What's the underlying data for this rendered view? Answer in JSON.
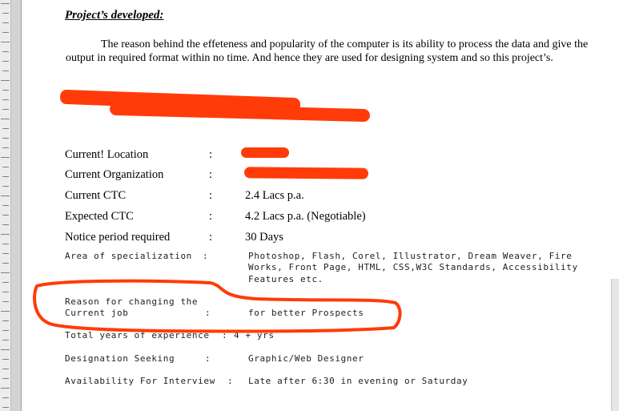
{
  "document": {
    "heading": "Project’s developed:",
    "paragraph": "The reason behind the effeteness and popularity of the computer is its ability to process the data and give the output in required format within no time. And hence they are used for designing system and so this project’s.",
    "colon": ":",
    "details": [
      {
        "label": "Current! Location",
        "value": ""
      },
      {
        "label": "Current Organization",
        "value": ""
      },
      {
        "label": "Current CTC",
        "value": "2.4 Lacs p.a."
      },
      {
        "label": "Expected CTC",
        "value": "4.2 Lacs p.a. (Negotiable)"
      },
      {
        "label": "Notice period required",
        "value": "30 Days"
      }
    ],
    "specialization": {
      "label": "Area of specialization",
      "value_line1": "Photoshop, Flash, Corel, Illustrator, Dream Weaver, Fire",
      "value_line2": "Works, Front Page, HTML, CSS,W3C Standards, Accessibility",
      "value_line3": "Features etc."
    },
    "reason": {
      "label_line1": "Reason for changing the",
      "label_line2": "Current job",
      "value": "for better Prospects"
    },
    "experience": {
      "label": "Total years of experience",
      "value": "4 + yrs"
    },
    "designation": {
      "label": "Designation Seeking",
      "value": "Graphic/Web Designer"
    },
    "availability": {
      "label": "Availability For Interview",
      "value": "Late after 6:30 in evening or Saturday"
    }
  },
  "colors": {
    "redaction": "#ff3b0a",
    "annotation_circle": "#ff3b0a"
  }
}
